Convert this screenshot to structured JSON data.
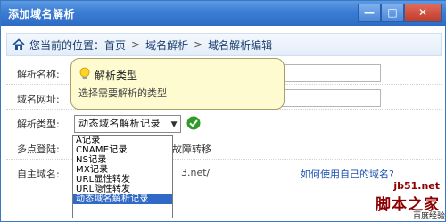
{
  "window": {
    "title": "添加域名解析",
    "minimize_label": "—",
    "maximize_label": "□",
    "close_label": "✕"
  },
  "breadcrumb": {
    "prefix": "您当前的位置：",
    "items": [
      "首页",
      "域名解析",
      "域名解析编辑"
    ],
    "separator": ">"
  },
  "form": {
    "resolve_name_label": "解析名称:",
    "domain_url_label": "域名网址:",
    "resolve_type_label": "解析类型:",
    "resolve_type_value": "动态域名解析记录",
    "multipoint_label": "多点登陆:",
    "multipoint_text": "故障转移",
    "own_domain_label": "自主域名:",
    "own_domain_text": "3.net/",
    "own_domain_help": "如何使用自己的域名?"
  },
  "tooltip": {
    "title": "解析类型",
    "description": "选择需要解析的类型"
  },
  "dropdown": {
    "options": [
      "A记录",
      "CNAME记录",
      "NS记录",
      "MX记录",
      "URL显性转发",
      "URL隐性转发",
      "动态域名解析记录"
    ],
    "selected_index": 6
  },
  "watermark": {
    "site": "jb51.net",
    "brand": "脚本之家",
    "corner": "百度经验"
  },
  "colors": {
    "titlebar": "#3b7cd4",
    "accent": "#3169c6",
    "tooltip_bg": "#fdfbcf",
    "watermark": "#8b0000"
  }
}
